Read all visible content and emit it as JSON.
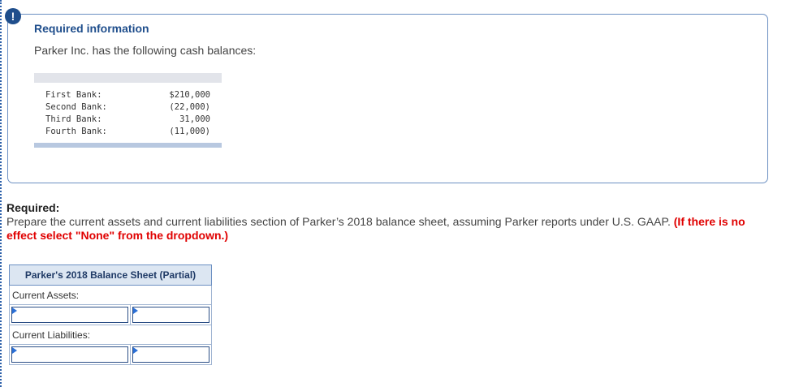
{
  "alert_icon": "exclamation-icon",
  "info": {
    "title": "Required information",
    "text": "Parker Inc. has the following cash balances:",
    "cash_balances": [
      {
        "bank": "First Bank:",
        "amount": "$210,000"
      },
      {
        "bank": "Second Bank:",
        "amount": "(22,000)"
      },
      {
        "bank": "Third Bank:",
        "amount": "31,000"
      },
      {
        "bank": "Fourth Bank:",
        "amount": "(11,000)"
      }
    ]
  },
  "required": {
    "label": "Required:",
    "prompt": "Prepare the current assets and current liabilities section of Parker’s 2018 balance sheet, assuming Parker reports under U.S. GAAP.",
    "note": "(If there is no effect select \"None\" from the dropdown.)"
  },
  "balance_sheet": {
    "header": "Parker's 2018 Balance Sheet (Partial)",
    "current_assets_label": "Current Assets:",
    "current_liabilities_label": "Current Liabilities:",
    "assets_row": {
      "dropdown_value": "",
      "amount_value": ""
    },
    "liabilities_row": {
      "dropdown_value": "",
      "amount_value": ""
    }
  },
  "colors": {
    "accent": "#1f4e8c",
    "note_red": "#e00000",
    "header_bg": "#dce6f2"
  }
}
